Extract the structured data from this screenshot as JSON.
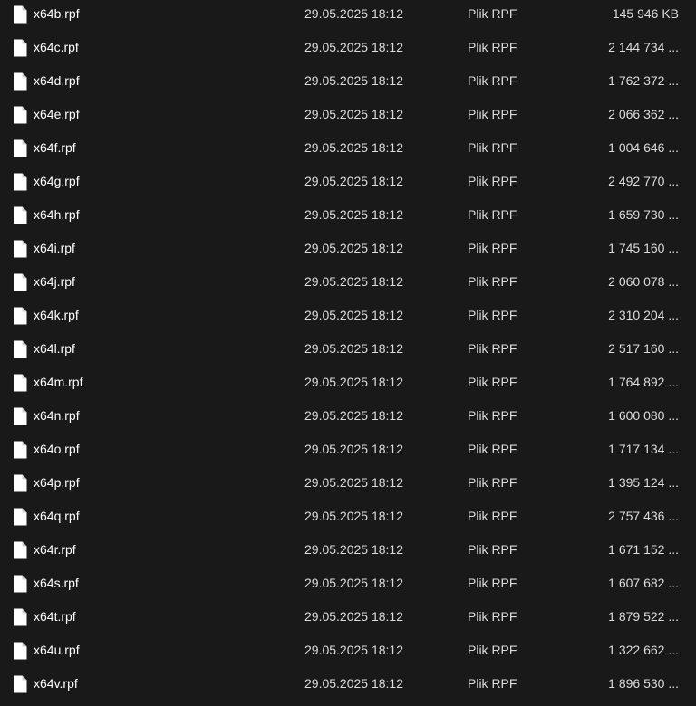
{
  "file_list": {
    "icon": "document-icon",
    "rows": [
      {
        "name": "x64b.rpf",
        "modified": "29.05.2025 18:12",
        "type": "Plik RPF",
        "size": "145 946 KB"
      },
      {
        "name": "x64c.rpf",
        "modified": "29.05.2025 18:12",
        "type": "Plik RPF",
        "size": "2 144 734 ..."
      },
      {
        "name": "x64d.rpf",
        "modified": "29.05.2025 18:12",
        "type": "Plik RPF",
        "size": "1 762 372 ..."
      },
      {
        "name": "x64e.rpf",
        "modified": "29.05.2025 18:12",
        "type": "Plik RPF",
        "size": "2 066 362 ..."
      },
      {
        "name": "x64f.rpf",
        "modified": "29.05.2025 18:12",
        "type": "Plik RPF",
        "size": "1 004 646 ..."
      },
      {
        "name": "x64g.rpf",
        "modified": "29.05.2025 18:12",
        "type": "Plik RPF",
        "size": "2 492 770 ..."
      },
      {
        "name": "x64h.rpf",
        "modified": "29.05.2025 18:12",
        "type": "Plik RPF",
        "size": "1 659 730 ..."
      },
      {
        "name": "x64i.rpf",
        "modified": "29.05.2025 18:12",
        "type": "Plik RPF",
        "size": "1 745 160 ..."
      },
      {
        "name": "x64j.rpf",
        "modified": "29.05.2025 18:12",
        "type": "Plik RPF",
        "size": "2 060 078 ..."
      },
      {
        "name": "x64k.rpf",
        "modified": "29.05.2025 18:12",
        "type": "Plik RPF",
        "size": "2 310 204 ..."
      },
      {
        "name": "x64l.rpf",
        "modified": "29.05.2025 18:12",
        "type": "Plik RPF",
        "size": "2 517 160 ..."
      },
      {
        "name": "x64m.rpf",
        "modified": "29.05.2025 18:12",
        "type": "Plik RPF",
        "size": "1 764 892 ..."
      },
      {
        "name": "x64n.rpf",
        "modified": "29.05.2025 18:12",
        "type": "Plik RPF",
        "size": "1 600 080 ..."
      },
      {
        "name": "x64o.rpf",
        "modified": "29.05.2025 18:12",
        "type": "Plik RPF",
        "size": "1 717 134 ..."
      },
      {
        "name": "x64p.rpf",
        "modified": "29.05.2025 18:12",
        "type": "Plik RPF",
        "size": "1 395 124 ..."
      },
      {
        "name": "x64q.rpf",
        "modified": "29.05.2025 18:12",
        "type": "Plik RPF",
        "size": "2 757 436 ..."
      },
      {
        "name": "x64r.rpf",
        "modified": "29.05.2025 18:12",
        "type": "Plik RPF",
        "size": "1 671 152 ..."
      },
      {
        "name": "x64s.rpf",
        "modified": "29.05.2025 18:12",
        "type": "Plik RPF",
        "size": "1 607 682 ..."
      },
      {
        "name": "x64t.rpf",
        "modified": "29.05.2025 18:12",
        "type": "Plik RPF",
        "size": "1 879 522 ..."
      },
      {
        "name": "x64u.rpf",
        "modified": "29.05.2025 18:12",
        "type": "Plik RPF",
        "size": "1 322 662 ..."
      },
      {
        "name": "x64v.rpf",
        "modified": "29.05.2025 18:12",
        "type": "Plik RPF",
        "size": "1 896 530 ..."
      }
    ]
  }
}
